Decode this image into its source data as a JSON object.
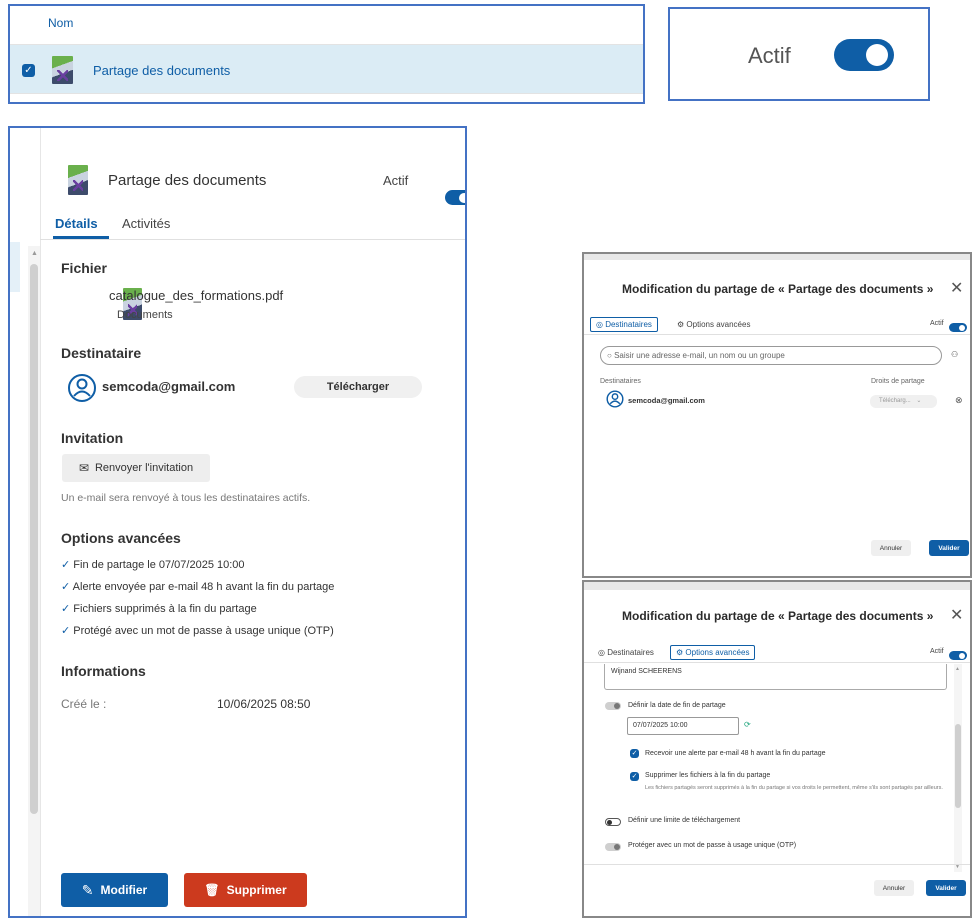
{
  "table": {
    "column_name": "Nom",
    "row_name": "Partage des documents"
  },
  "status_zoom": {
    "label": "Actif"
  },
  "panel": {
    "title": "Partage des documents",
    "status_label": "Actif",
    "tabs": [
      "Détails",
      "Activités"
    ],
    "file_heading": "Fichier",
    "file_name": "catalogue_des_formations.pdf",
    "file_folder": "Documents",
    "recipient_heading": "Destinataire",
    "recipient_email": "semcoda@gmail.com",
    "recipient_right": "Télécharger",
    "invitation_heading": "Invitation",
    "resend_label": "Renvoyer l'invitation",
    "resend_note": "Un e-mail sera renvoyé à tous les destinataires actifs.",
    "advanced_heading": "Options avancées",
    "advanced_items": [
      "Fin de partage le 07/07/2025 10:00",
      "Alerte envoyée par e-mail 48 h avant la fin du partage",
      "Fichiers supprimés à la fin du partage",
      "Protégé avec un mot de passe à usage unique (OTP)"
    ],
    "info_heading": "Informations",
    "created_label": "Créé le :",
    "created_value": "10/06/2025 08:50",
    "edit_label": "Modifier",
    "delete_label": "Supprimer"
  },
  "modal1": {
    "title": "Modification du partage de « Partage des documents »",
    "tab_recipients": "Destinataires",
    "tab_advanced": "Options avancées",
    "status_label": "Actif",
    "search_placeholder": "Saisir une adresse e-mail, un nom ou un groupe",
    "col_recipients": "Destinataires",
    "col_rights": "Droits de partage",
    "recipient_email": "semcoda@gmail.com",
    "recipient_right": "Télécharg...",
    "cancel": "Annuler",
    "validate": "Valider"
  },
  "modal2": {
    "title": "Modification du partage de « Partage des documents »",
    "tab_recipients": "Destinataires",
    "tab_advanced": "Options avancées",
    "status_label": "Actif",
    "message_name": "Wijnand SCHEERENS",
    "end_date_label": "Définir la date de fin de partage",
    "end_date_value": "07/07/2025 10:00",
    "alert_label": "Recevoir une alerte par e-mail 48 h avant la fin du partage",
    "delete_files_label": "Supprimer les fichiers à la fin du partage",
    "delete_files_note": "Les fichiers partagés seront supprimés à la fin du partage si vos droits le permettent, même s'ils sont partagés par ailleurs.",
    "download_limit_label": "Définir une limite de téléchargement",
    "otp_label": "Protéger avec un mot de passe à usage unique (OTP)",
    "cancel": "Annuler",
    "validate": "Valider"
  }
}
